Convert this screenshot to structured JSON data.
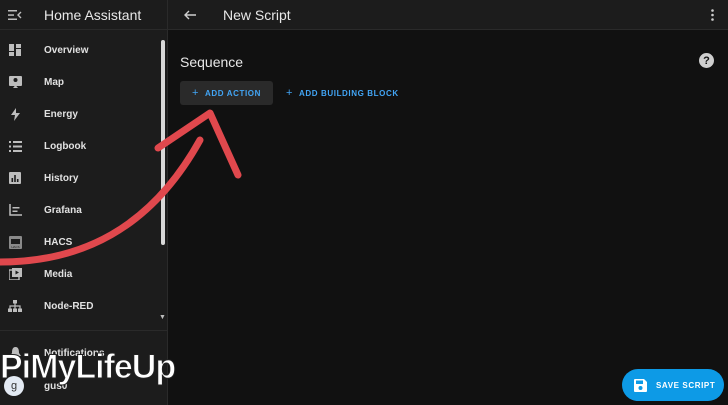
{
  "sidebar": {
    "app_title": "Home Assistant",
    "items": [
      {
        "label": "Overview",
        "icon": "dashboard-icon"
      },
      {
        "label": "Map",
        "icon": "map-icon"
      },
      {
        "label": "Energy",
        "icon": "lightning-icon"
      },
      {
        "label": "Logbook",
        "icon": "list-icon"
      },
      {
        "label": "History",
        "icon": "chart-box-icon"
      },
      {
        "label": "Grafana",
        "icon": "chart-line-icon"
      },
      {
        "label": "HACS",
        "icon": "hacs-icon"
      },
      {
        "label": "Media",
        "icon": "play-box-icon"
      },
      {
        "label": "Node-RED",
        "icon": "sitemap-icon"
      }
    ],
    "notifications_label": "Notifications",
    "user": {
      "initial": "g",
      "name": "gus0"
    }
  },
  "topbar": {
    "title": "New Script"
  },
  "main": {
    "section_title": "Sequence",
    "add_action_label": "ADD ACTION",
    "add_block_label": "ADD BUILDING BLOCK",
    "save_label": "SAVE SCRIPT"
  },
  "watermark": {
    "text": "PiMyLifeUp"
  },
  "colors": {
    "accent": "#42a5f5",
    "save_button": "#0d9ae6",
    "arrow": "#e0484d",
    "sidebar_bg": "#1c1c1c",
    "main_bg": "#111111"
  }
}
